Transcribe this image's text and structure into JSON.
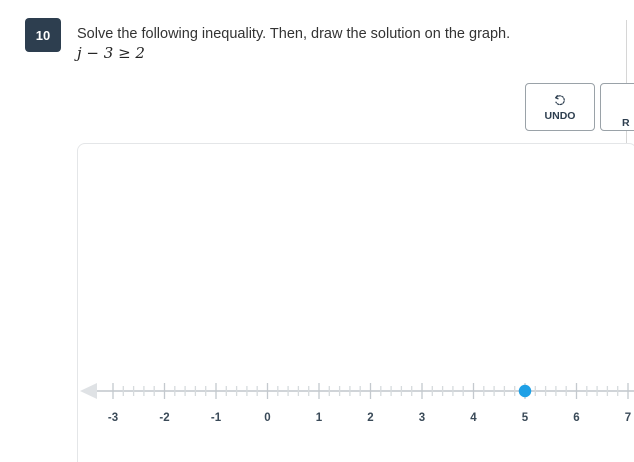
{
  "question": {
    "number": "10",
    "prompt": "Solve the following inequality. Then, draw the solution on the graph.",
    "equation": "j − 3 ≥ 2"
  },
  "toolbar": {
    "undo_label": "UNDO",
    "next_label": "R"
  },
  "number_line": {
    "tick_labels": [
      "-3",
      "-2",
      "-1",
      "0",
      "1",
      "2",
      "3",
      "4",
      "5",
      "6",
      "7"
    ],
    "min": -3,
    "max": 7,
    "minor_ticks_per_unit": 5,
    "plotted_point": 5,
    "point_filled": true,
    "point_color": "#1ea0e6",
    "line_color": "#d0d4d8",
    "arrow_left": true
  },
  "colors": {
    "badge_bg": "#2d3e4f",
    "text": "#333333"
  }
}
